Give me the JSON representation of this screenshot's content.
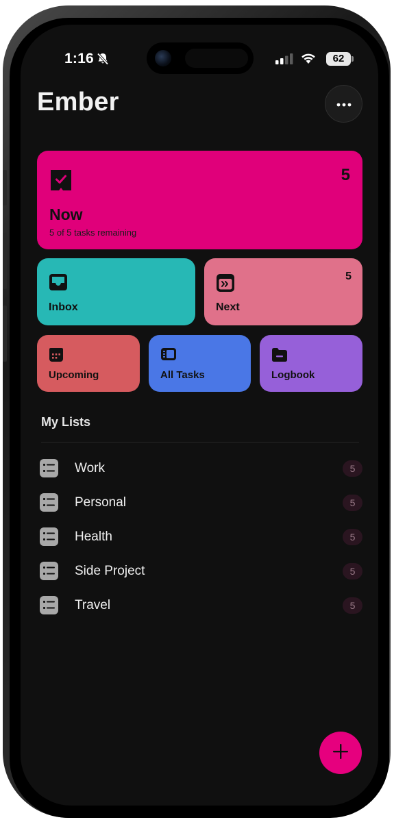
{
  "status_bar": {
    "time": "1:16",
    "battery": "62",
    "icons": [
      "bell-slash-icon",
      "signal-icon",
      "wifi-icon",
      "battery-icon"
    ]
  },
  "header": {
    "title": "Ember",
    "more_icon": "ellipsis-icon"
  },
  "smart_lists": {
    "now": {
      "label": "Now",
      "count": "5",
      "subtitle": "5 of 5 tasks remaining",
      "icon": "checkbox-icon",
      "color": "#e0007a"
    },
    "inbox": {
      "label": "Inbox",
      "icon": "inbox-icon",
      "color": "#27b8b5"
    },
    "next": {
      "label": "Next",
      "count": "5",
      "icon": "next-icon",
      "color": "#e0718a"
    },
    "upcoming": {
      "label": "Upcoming",
      "icon": "calendar-icon",
      "color": "#d65b5f"
    },
    "all_tasks": {
      "label": "All Tasks",
      "icon": "sidebar-icon",
      "color": "#4a77e6"
    },
    "logbook": {
      "label": "Logbook",
      "icon": "folder-icon",
      "color": "#9660d9"
    }
  },
  "my_lists": {
    "title": "My Lists",
    "items": [
      {
        "label": "Work",
        "count": "5"
      },
      {
        "label": "Personal",
        "count": "5"
      },
      {
        "label": "Health",
        "count": "5"
      },
      {
        "label": "Side Project",
        "count": "5"
      },
      {
        "label": "Travel",
        "count": "5"
      }
    ]
  },
  "fab": {
    "icon": "plus-icon",
    "color": "#e6007e"
  }
}
